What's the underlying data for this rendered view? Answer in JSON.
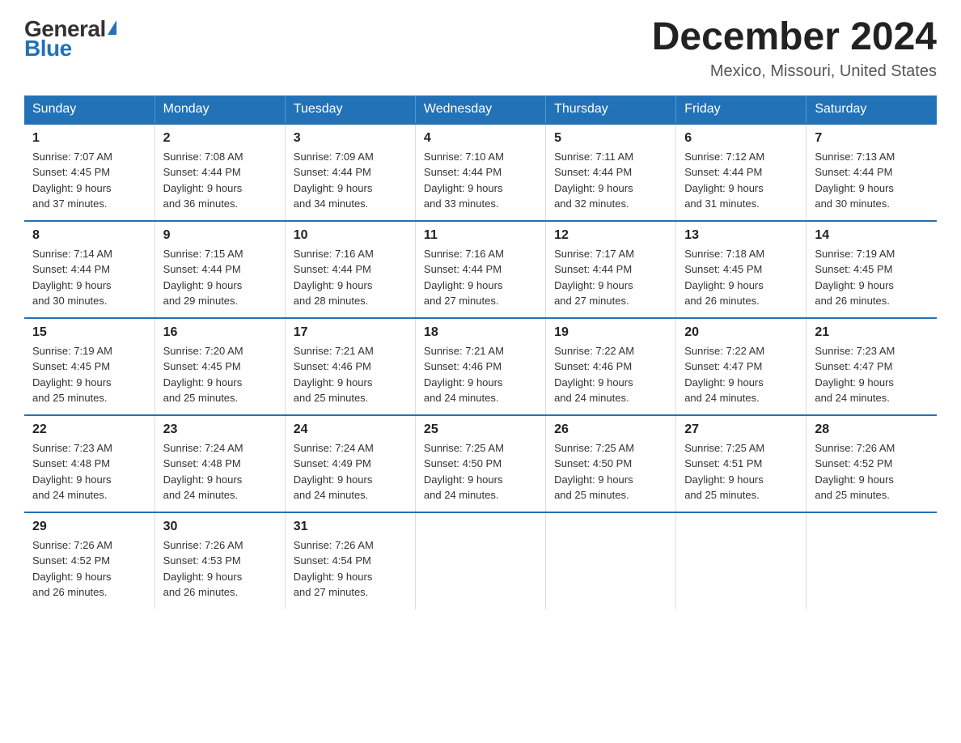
{
  "header": {
    "logo_general": "General",
    "logo_blue": "Blue",
    "month_title": "December 2024",
    "location": "Mexico, Missouri, United States"
  },
  "weekdays": [
    "Sunday",
    "Monday",
    "Tuesday",
    "Wednesday",
    "Thursday",
    "Friday",
    "Saturday"
  ],
  "weeks": [
    [
      {
        "day": "1",
        "sunrise": "7:07 AM",
        "sunset": "4:45 PM",
        "daylight": "9 hours and 37 minutes."
      },
      {
        "day": "2",
        "sunrise": "7:08 AM",
        "sunset": "4:44 PM",
        "daylight": "9 hours and 36 minutes."
      },
      {
        "day": "3",
        "sunrise": "7:09 AM",
        "sunset": "4:44 PM",
        "daylight": "9 hours and 34 minutes."
      },
      {
        "day": "4",
        "sunrise": "7:10 AM",
        "sunset": "4:44 PM",
        "daylight": "9 hours and 33 minutes."
      },
      {
        "day": "5",
        "sunrise": "7:11 AM",
        "sunset": "4:44 PM",
        "daylight": "9 hours and 32 minutes."
      },
      {
        "day": "6",
        "sunrise": "7:12 AM",
        "sunset": "4:44 PM",
        "daylight": "9 hours and 31 minutes."
      },
      {
        "day": "7",
        "sunrise": "7:13 AM",
        "sunset": "4:44 PM",
        "daylight": "9 hours and 30 minutes."
      }
    ],
    [
      {
        "day": "8",
        "sunrise": "7:14 AM",
        "sunset": "4:44 PM",
        "daylight": "9 hours and 30 minutes."
      },
      {
        "day": "9",
        "sunrise": "7:15 AM",
        "sunset": "4:44 PM",
        "daylight": "9 hours and 29 minutes."
      },
      {
        "day": "10",
        "sunrise": "7:16 AM",
        "sunset": "4:44 PM",
        "daylight": "9 hours and 28 minutes."
      },
      {
        "day": "11",
        "sunrise": "7:16 AM",
        "sunset": "4:44 PM",
        "daylight": "9 hours and 27 minutes."
      },
      {
        "day": "12",
        "sunrise": "7:17 AM",
        "sunset": "4:44 PM",
        "daylight": "9 hours and 27 minutes."
      },
      {
        "day": "13",
        "sunrise": "7:18 AM",
        "sunset": "4:45 PM",
        "daylight": "9 hours and 26 minutes."
      },
      {
        "day": "14",
        "sunrise": "7:19 AM",
        "sunset": "4:45 PM",
        "daylight": "9 hours and 26 minutes."
      }
    ],
    [
      {
        "day": "15",
        "sunrise": "7:19 AM",
        "sunset": "4:45 PM",
        "daylight": "9 hours and 25 minutes."
      },
      {
        "day": "16",
        "sunrise": "7:20 AM",
        "sunset": "4:45 PM",
        "daylight": "9 hours and 25 minutes."
      },
      {
        "day": "17",
        "sunrise": "7:21 AM",
        "sunset": "4:46 PM",
        "daylight": "9 hours and 25 minutes."
      },
      {
        "day": "18",
        "sunrise": "7:21 AM",
        "sunset": "4:46 PM",
        "daylight": "9 hours and 24 minutes."
      },
      {
        "day": "19",
        "sunrise": "7:22 AM",
        "sunset": "4:46 PM",
        "daylight": "9 hours and 24 minutes."
      },
      {
        "day": "20",
        "sunrise": "7:22 AM",
        "sunset": "4:47 PM",
        "daylight": "9 hours and 24 minutes."
      },
      {
        "day": "21",
        "sunrise": "7:23 AM",
        "sunset": "4:47 PM",
        "daylight": "9 hours and 24 minutes."
      }
    ],
    [
      {
        "day": "22",
        "sunrise": "7:23 AM",
        "sunset": "4:48 PM",
        "daylight": "9 hours and 24 minutes."
      },
      {
        "day": "23",
        "sunrise": "7:24 AM",
        "sunset": "4:48 PM",
        "daylight": "9 hours and 24 minutes."
      },
      {
        "day": "24",
        "sunrise": "7:24 AM",
        "sunset": "4:49 PM",
        "daylight": "9 hours and 24 minutes."
      },
      {
        "day": "25",
        "sunrise": "7:25 AM",
        "sunset": "4:50 PM",
        "daylight": "9 hours and 24 minutes."
      },
      {
        "day": "26",
        "sunrise": "7:25 AM",
        "sunset": "4:50 PM",
        "daylight": "9 hours and 25 minutes."
      },
      {
        "day": "27",
        "sunrise": "7:25 AM",
        "sunset": "4:51 PM",
        "daylight": "9 hours and 25 minutes."
      },
      {
        "day": "28",
        "sunrise": "7:26 AM",
        "sunset": "4:52 PM",
        "daylight": "9 hours and 25 minutes."
      }
    ],
    [
      {
        "day": "29",
        "sunrise": "7:26 AM",
        "sunset": "4:52 PM",
        "daylight": "9 hours and 26 minutes."
      },
      {
        "day": "30",
        "sunrise": "7:26 AM",
        "sunset": "4:53 PM",
        "daylight": "9 hours and 26 minutes."
      },
      {
        "day": "31",
        "sunrise": "7:26 AM",
        "sunset": "4:54 PM",
        "daylight": "9 hours and 27 minutes."
      },
      null,
      null,
      null,
      null
    ]
  ],
  "labels": {
    "sunrise_prefix": "Sunrise: ",
    "sunset_prefix": "Sunset: ",
    "daylight_prefix": "Daylight: "
  }
}
